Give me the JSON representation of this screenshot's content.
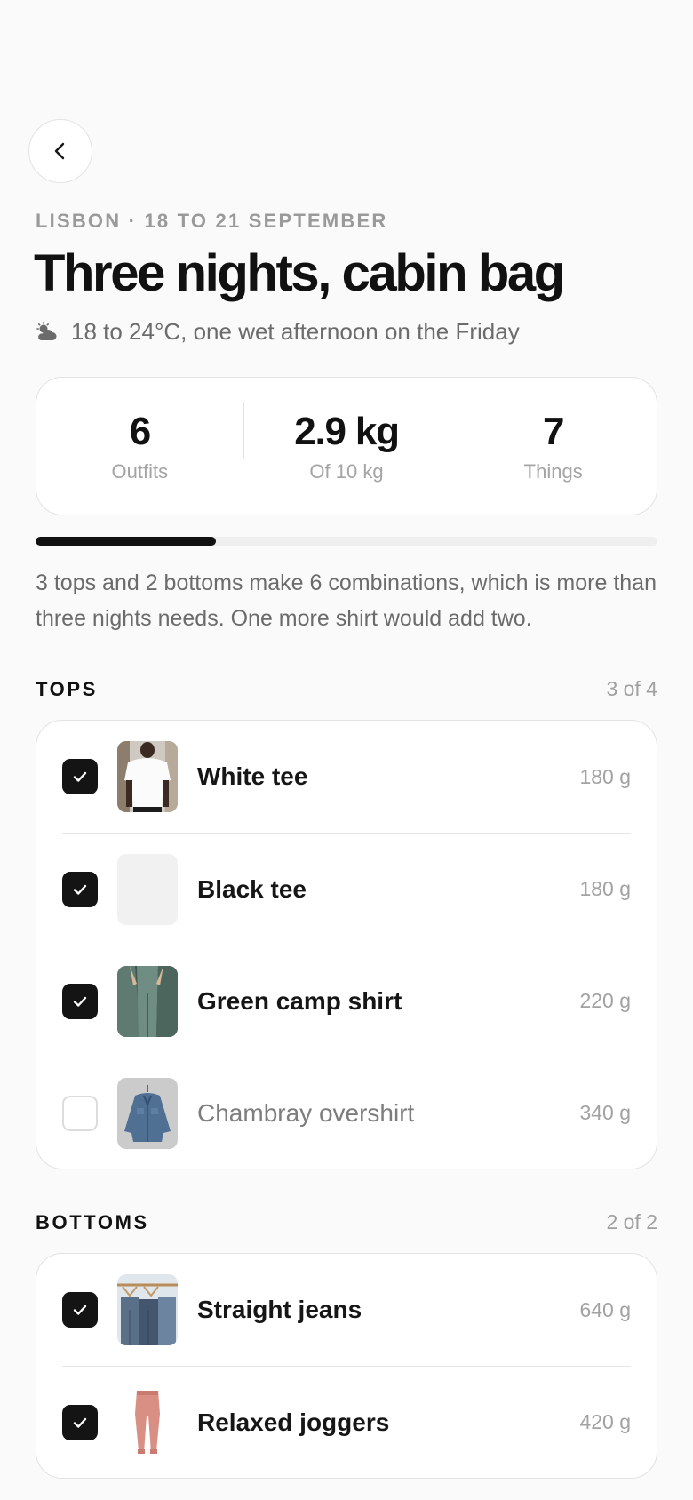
{
  "trip": {
    "eyebrow": "LISBON · 18 TO 21 SEPTEMBER",
    "title": "Three nights, cabin bag",
    "weather": "18 to 24°C, one wet afternoon on the Friday",
    "weather_icon": "cloud-sun-icon"
  },
  "stats": [
    {
      "value": "6",
      "label": "Outfits"
    },
    {
      "value": "2.9 kg",
      "label": "Of 10 kg"
    },
    {
      "value": "7",
      "label": "Things"
    }
  ],
  "progress": {
    "fraction": 0.29
  },
  "note": "3 tops and 2 bottoms make 6 combinations, which is more than three nights needs. One more shirt would add two.",
  "sections": {
    "tops": {
      "title": "TOPS",
      "count": "3 of 4",
      "items": [
        {
          "name": "White tee",
          "weight": "180 g",
          "checked": true
        },
        {
          "name": "Black tee",
          "weight": "180 g",
          "checked": true
        },
        {
          "name": "Green camp shirt",
          "weight": "220 g",
          "checked": true
        },
        {
          "name": "Chambray overshirt",
          "weight": "340 g",
          "checked": false
        }
      ]
    },
    "bottoms": {
      "title": "BOTTOMS",
      "count": "2 of 2",
      "items": [
        {
          "name": "Straight jeans",
          "weight": "640 g",
          "checked": true
        },
        {
          "name": "Relaxed joggers",
          "weight": "420 g",
          "checked": true
        }
      ]
    }
  },
  "colors": {
    "accent": "#111111",
    "muted": "#9a9a9a",
    "border": "#e3e3e3"
  }
}
